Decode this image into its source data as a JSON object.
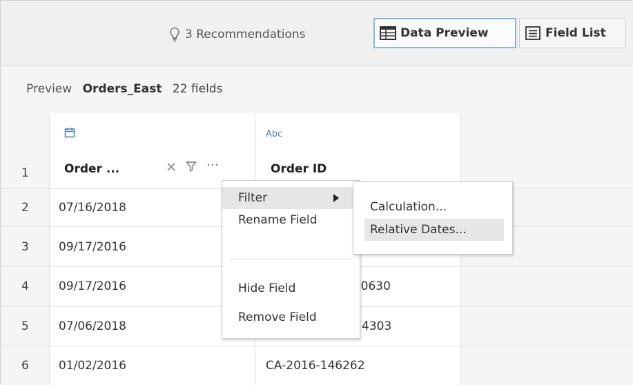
{
  "toolbar": {
    "recommendations_label": "3 Recommendations",
    "data_preview_label": "Data Preview",
    "field_list_label": "Field List"
  },
  "preview": {
    "label": "Preview",
    "source_name": "Orders_East",
    "field_count": "22 fields"
  },
  "grid": {
    "columns": [
      {
        "type_label": "",
        "type_icon": "calendar-icon",
        "name": "Order ..."
      },
      {
        "type_label": "Abc",
        "type_icon": "string-type",
        "name": "Order ID"
      }
    ],
    "header_row_number": "1",
    "rows": [
      {
        "num": "2",
        "c1": "07/16/2018",
        "c2": ""
      },
      {
        "num": "3",
        "c1": "09/17/2016",
        "c2": ""
      },
      {
        "num": "4",
        "c1": "09/17/2016",
        "c2": ")0630"
      },
      {
        "num": "5",
        "c1": "07/06/2018",
        "c2": "4303"
      },
      {
        "num": "6",
        "c1": "01/02/2016",
        "c2": "CA-2016-146262"
      }
    ]
  },
  "context_menu": {
    "items": [
      "Filter",
      "Rename Field",
      "Hide Field",
      "Remove Field"
    ]
  },
  "submenu": {
    "items": [
      "Calculation...",
      "Relative Dates..."
    ]
  },
  "colors": {
    "active_border": "#8cb4dc",
    "type_icon": "#4a7fb5"
  }
}
